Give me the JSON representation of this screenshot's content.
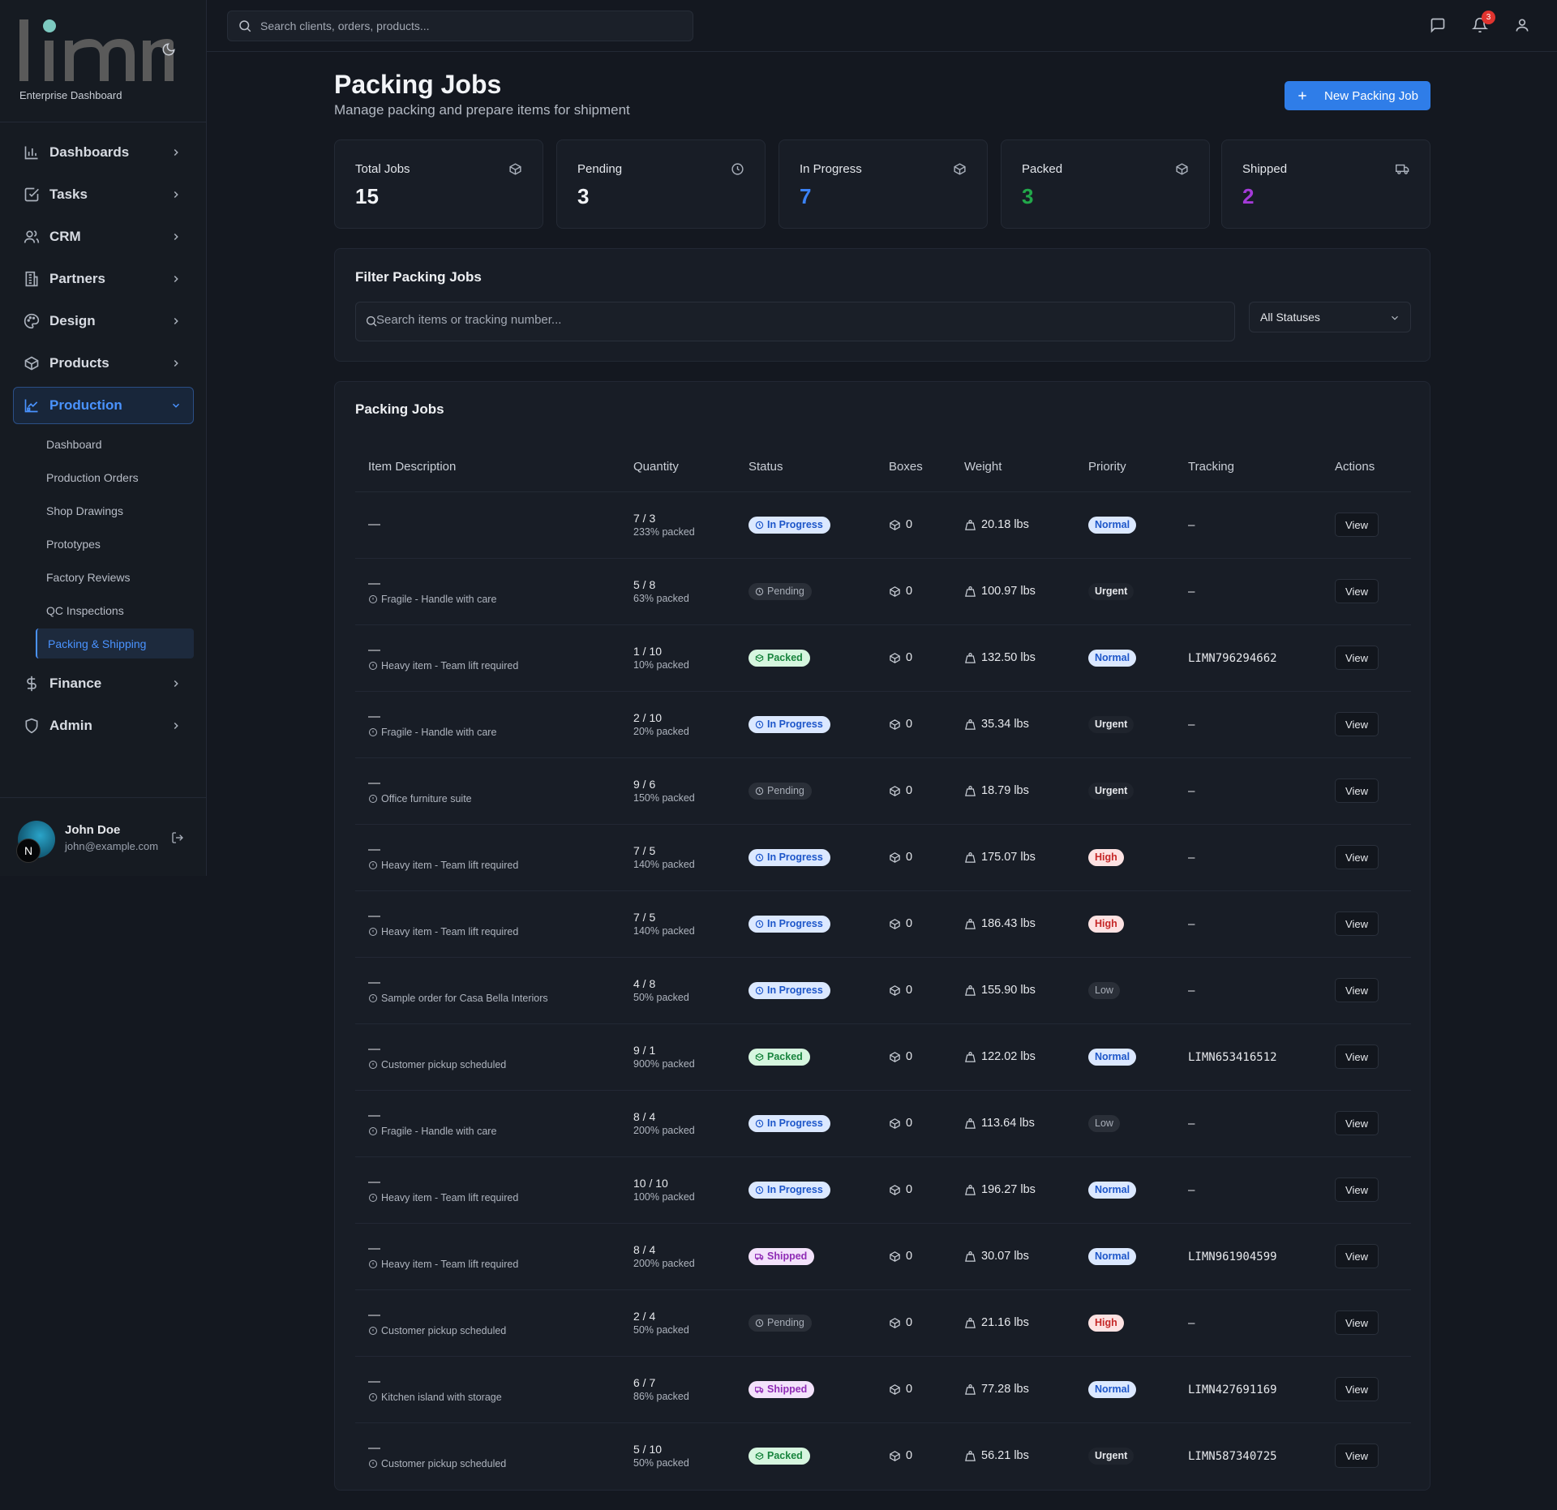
{
  "brand": {
    "logo_text": "limn",
    "subtitle": "Enterprise Dashboard"
  },
  "sidebar": {
    "items": [
      {
        "label": "Dashboards",
        "icon": "bar-chart-icon"
      },
      {
        "label": "Tasks",
        "icon": "checkbox-icon"
      },
      {
        "label": "CRM",
        "icon": "users-icon"
      },
      {
        "label": "Partners",
        "icon": "building-icon"
      },
      {
        "label": "Design",
        "icon": "palette-icon"
      },
      {
        "label": "Products",
        "icon": "box-icon"
      },
      {
        "label": "Production",
        "icon": "factory-icon",
        "expanded": true
      },
      {
        "label": "Finance",
        "icon": "dollar-icon"
      },
      {
        "label": "Admin",
        "icon": "shield-icon"
      }
    ],
    "production_sub": [
      "Dashboard",
      "Production Orders",
      "Shop Drawings",
      "Prototypes",
      "Factory Reviews",
      "QC Inspections",
      "Packing & Shipping"
    ],
    "active_sub": "Packing & Shipping"
  },
  "user": {
    "initial": "N",
    "name": "John Doe",
    "email": "john@example.com"
  },
  "topbar": {
    "search_placeholder": "Search clients, orders, products...",
    "notification_count": "3"
  },
  "page": {
    "title": "Packing Jobs",
    "subtitle": "Manage packing and prepare items for shipment",
    "new_button": "New Packing Job"
  },
  "stats": [
    {
      "label": "Total Jobs",
      "value": "15",
      "color": "#f2f4f7",
      "icon": "box-icon"
    },
    {
      "label": "Pending",
      "value": "3",
      "color": "#f2f4f7",
      "icon": "clock-icon"
    },
    {
      "label": "In Progress",
      "value": "7",
      "color": "#3b82f6",
      "icon": "box-icon"
    },
    {
      "label": "Packed",
      "value": "3",
      "color": "#22a84a",
      "icon": "box-icon"
    },
    {
      "label": "Shipped",
      "value": "2",
      "color": "#a43ad8",
      "icon": "truck-icon"
    }
  ],
  "filter": {
    "title": "Filter Packing Jobs",
    "search_placeholder": "Search items or tracking number...",
    "status_value": "All Statuses"
  },
  "table": {
    "title": "Packing Jobs",
    "columns": [
      "Item Description",
      "Quantity",
      "Status",
      "Boxes",
      "Weight",
      "Priority",
      "Tracking",
      "Actions"
    ],
    "view_label": "View",
    "rows": [
      {
        "desc": "—",
        "note": "",
        "qty": "7 / 3",
        "pct": "233% packed",
        "status": "In Progress",
        "boxes": "0",
        "weight": "20.18 lbs",
        "priority": "Normal",
        "tracking": "—"
      },
      {
        "desc": "—",
        "note": "Fragile - Handle with care",
        "qty": "5 / 8",
        "pct": "63% packed",
        "status": "Pending",
        "boxes": "0",
        "weight": "100.97 lbs",
        "priority": "Urgent",
        "tracking": "—"
      },
      {
        "desc": "—",
        "note": "Heavy item - Team lift required",
        "qty": "1 / 10",
        "pct": "10% packed",
        "status": "Packed",
        "boxes": "0",
        "weight": "132.50 lbs",
        "priority": "Normal",
        "tracking": "LIMN796294662"
      },
      {
        "desc": "—",
        "note": "Fragile - Handle with care",
        "qty": "2 / 10",
        "pct": "20% packed",
        "status": "In Progress",
        "boxes": "0",
        "weight": "35.34 lbs",
        "priority": "Urgent",
        "tracking": "—"
      },
      {
        "desc": "—",
        "note": "Office furniture suite",
        "qty": "9 / 6",
        "pct": "150% packed",
        "status": "Pending",
        "boxes": "0",
        "weight": "18.79 lbs",
        "priority": "Urgent",
        "tracking": "—"
      },
      {
        "desc": "—",
        "note": "Heavy item - Team lift required",
        "qty": "7 / 5",
        "pct": "140% packed",
        "status": "In Progress",
        "boxes": "0",
        "weight": "175.07 lbs",
        "priority": "High",
        "tracking": "—"
      },
      {
        "desc": "—",
        "note": "Heavy item - Team lift required",
        "qty": "7 / 5",
        "pct": "140% packed",
        "status": "In Progress",
        "boxes": "0",
        "weight": "186.43 lbs",
        "priority": "High",
        "tracking": "—"
      },
      {
        "desc": "—",
        "note": "Sample order for Casa Bella Interiors",
        "qty": "4 / 8",
        "pct": "50% packed",
        "status": "In Progress",
        "boxes": "0",
        "weight": "155.90 lbs",
        "priority": "Low",
        "tracking": "—"
      },
      {
        "desc": "—",
        "note": "Customer pickup scheduled",
        "qty": "9 / 1",
        "pct": "900% packed",
        "status": "Packed",
        "boxes": "0",
        "weight": "122.02 lbs",
        "priority": "Normal",
        "tracking": "LIMN653416512"
      },
      {
        "desc": "—",
        "note": "Fragile - Handle with care",
        "qty": "8 / 4",
        "pct": "200% packed",
        "status": "In Progress",
        "boxes": "0",
        "weight": "113.64 lbs",
        "priority": "Low",
        "tracking": "—"
      },
      {
        "desc": "—",
        "note": "Heavy item - Team lift required",
        "qty": "10 / 10",
        "pct": "100% packed",
        "status": "In Progress",
        "boxes": "0",
        "weight": "196.27 lbs",
        "priority": "Normal",
        "tracking": "—"
      },
      {
        "desc": "—",
        "note": "Heavy item - Team lift required",
        "qty": "8 / 4",
        "pct": "200% packed",
        "status": "Shipped",
        "boxes": "0",
        "weight": "30.07 lbs",
        "priority": "Normal",
        "tracking": "LIMN961904599"
      },
      {
        "desc": "—",
        "note": "Customer pickup scheduled",
        "qty": "2 / 4",
        "pct": "50% packed",
        "status": "Pending",
        "boxes": "0",
        "weight": "21.16 lbs",
        "priority": "High",
        "tracking": "—"
      },
      {
        "desc": "—",
        "note": "Kitchen island with storage",
        "qty": "6 / 7",
        "pct": "86% packed",
        "status": "Shipped",
        "boxes": "0",
        "weight": "77.28 lbs",
        "priority": "Normal",
        "tracking": "LIMN427691169"
      },
      {
        "desc": "—",
        "note": "Customer pickup scheduled",
        "qty": "5 / 10",
        "pct": "50% packed",
        "status": "Packed",
        "boxes": "0",
        "weight": "56.21 lbs",
        "priority": "Urgent",
        "tracking": "LIMN587340725"
      }
    ]
  }
}
